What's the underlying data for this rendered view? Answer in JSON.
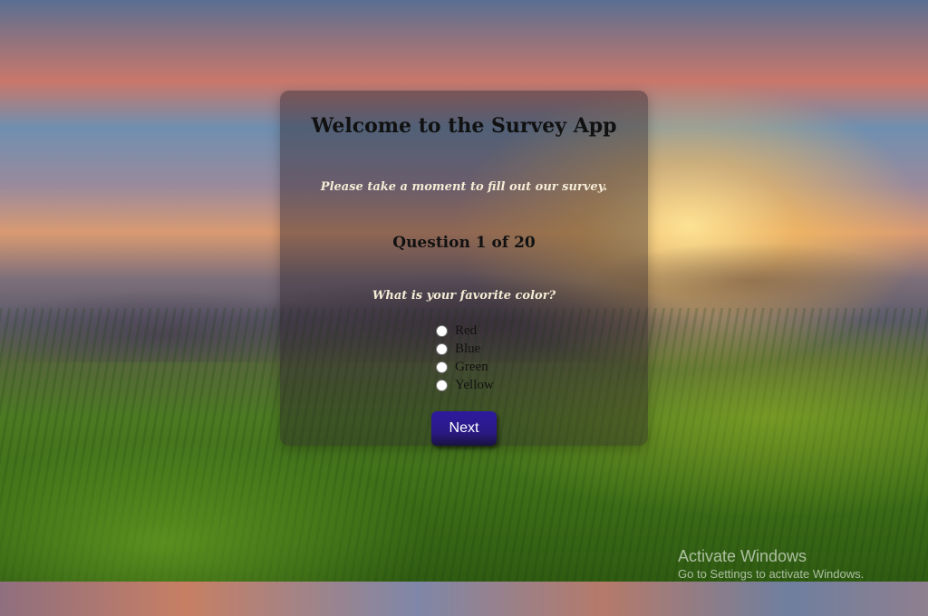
{
  "survey": {
    "title": "Welcome to the Survey App",
    "subtitle": "Please take a moment to fill out our survey.",
    "counter": "Question 1 of 20",
    "question": "What is your favorite color?",
    "options": [
      "Red",
      "Blue",
      "Green",
      "Yellow"
    ],
    "next_label": "Next"
  },
  "watermark": {
    "title": "Activate Windows",
    "subtitle": "Go to Settings to activate Windows."
  }
}
